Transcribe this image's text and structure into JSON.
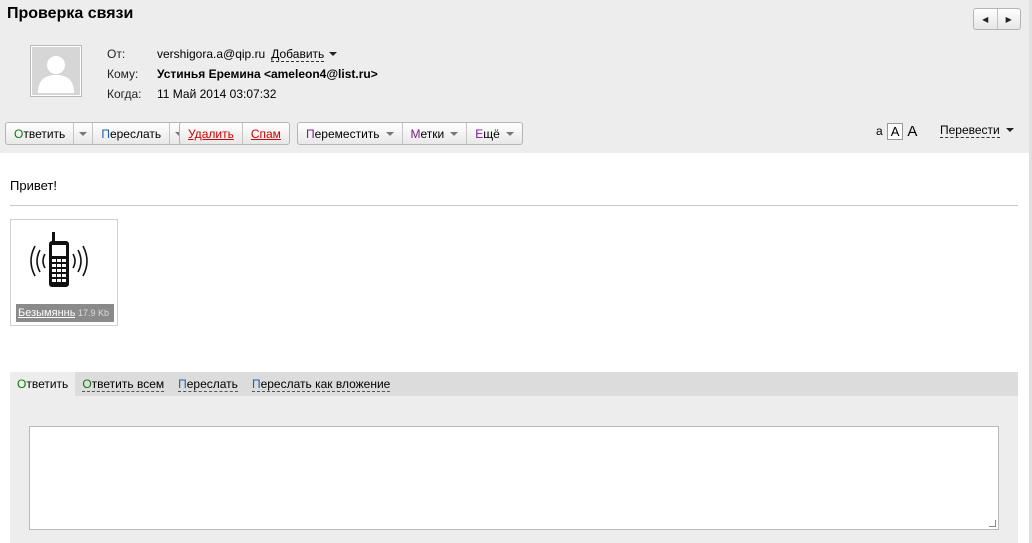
{
  "subject": "Проверка связи",
  "nav": {
    "prev_icon": "triangle-left",
    "next_icon": "triangle-right"
  },
  "meta": {
    "from_label": "От:",
    "from_value": "vershigora.a@qip.ru",
    "add_label": "Добавить",
    "to_label": "Кому:",
    "to_value": "Устинья Еремина <ameleon4@list.ru>",
    "when_label": "Когда:",
    "when_value": "11 Май 2014 03:07:32"
  },
  "toolbar": {
    "reply_first": "О",
    "reply_rest": "тветить",
    "forward_first": "П",
    "forward_rest": "ереслать",
    "delete": "Удалить",
    "spam": "Спам",
    "move_first": "П",
    "move_rest": "ереместить",
    "labels_first": "М",
    "labels_rest": "етки",
    "more_first": "Е",
    "more_rest": "щё"
  },
  "font_sizes": [
    "a",
    "A",
    "A"
  ],
  "translate": "Перевести",
  "body_text": "Привет!",
  "attachment": {
    "name": "Безымянный",
    "size": "17.9 Kb",
    "icon": "mobile-phone-ringing-icon"
  },
  "reply_tabs": [
    {
      "first": "О",
      "rest": "тветить"
    },
    {
      "first": "О",
      "rest": "тветить всем"
    },
    {
      "first": "П",
      "rest": "ереслать"
    },
    {
      "first": "П",
      "rest": "ереслать как вложение"
    }
  ],
  "colors": {
    "header_bg": "#ededed",
    "accent_green": "#0a7a0a",
    "accent_blue": "#1f5fb0",
    "accent_red": "#c00000",
    "accent_purple": "#7a1a8a"
  }
}
